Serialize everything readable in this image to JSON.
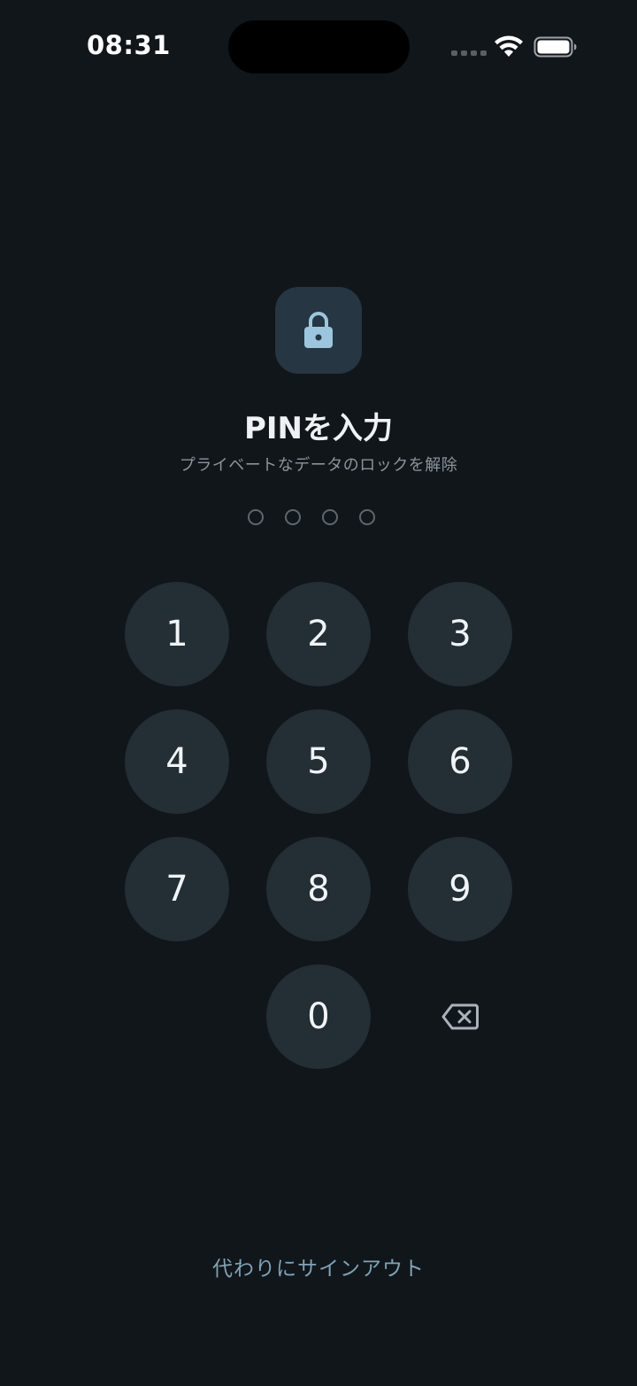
{
  "status_bar": {
    "time": "08:31",
    "wifi_icon": "wifi-icon",
    "battery_icon": "battery-icon"
  },
  "lock": {
    "icon": "lock-icon",
    "title": "PINを入力",
    "subtitle": "プライベートなデータのロックを解除"
  },
  "pin": {
    "length": 4,
    "entered": 0
  },
  "keypad": {
    "keys": [
      "1",
      "2",
      "3",
      "4",
      "5",
      "6",
      "7",
      "8",
      "9",
      "0"
    ],
    "backspace_icon": "backspace-icon"
  },
  "footer": {
    "signout_label": "代わりにサインアウト"
  },
  "colors": {
    "background": "#11161b",
    "key": "#232e35",
    "lock_tile": "#263642",
    "accent": "#7fa3b6",
    "lock_glyph": "#9cc6de"
  }
}
